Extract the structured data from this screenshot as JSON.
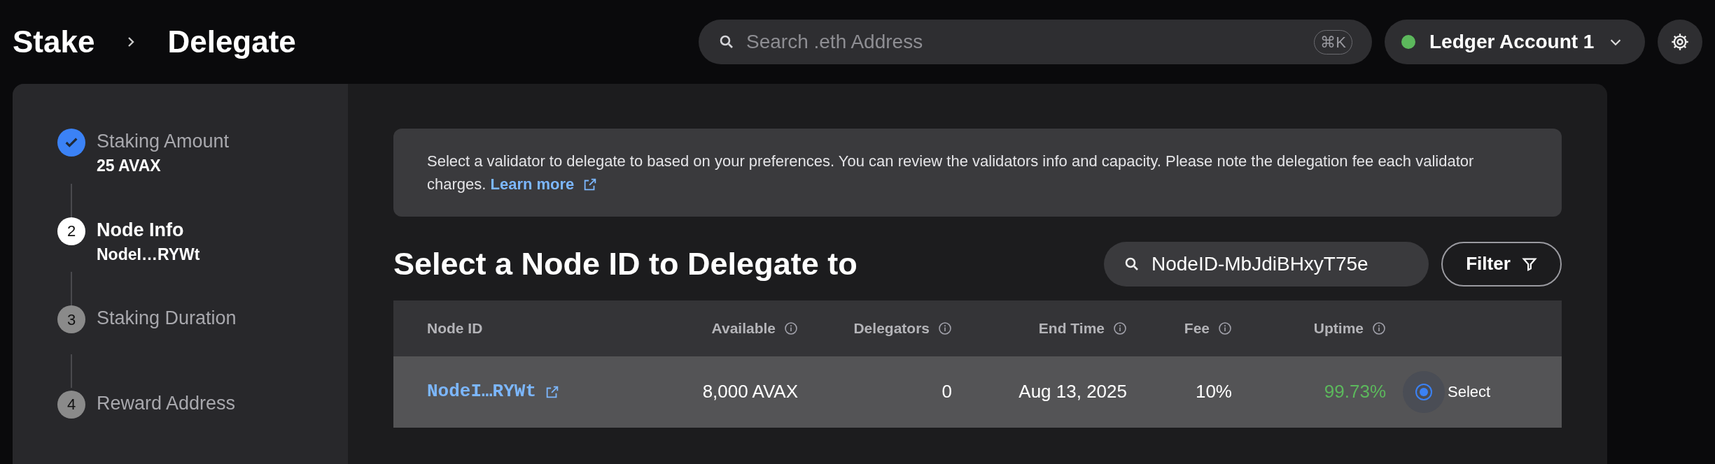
{
  "breadcrumb": [
    "Stake",
    "Delegate"
  ],
  "search": {
    "placeholder": "Search .eth Address",
    "shortcut": "⌘K"
  },
  "account": {
    "name": "Ledger Account 1",
    "connected": true
  },
  "steps": [
    {
      "kind": "done",
      "label": "Staking Amount",
      "value": "25 AVAX"
    },
    {
      "kind": "current",
      "number": "2",
      "label": "Node Info",
      "value": "NodeI…RYWt"
    },
    {
      "kind": "upcoming",
      "number": "3",
      "label": "Staking Duration"
    },
    {
      "kind": "upcoming",
      "number": "4",
      "label": "Reward Address"
    }
  ],
  "info_banner": {
    "text": "Select a validator to delegate to based on your preferences. You can review the validators info and capacity. Please note the delegation fee each validator charges.",
    "link": "Learn more"
  },
  "heading": "Select a Node ID to Delegate to",
  "node_search": {
    "value": "NodeID-MbJdiBHxyT75e"
  },
  "filter_button": "Filter",
  "table": {
    "columns": [
      {
        "label": "Node ID"
      },
      {
        "label": "Available",
        "info": true
      },
      {
        "label": "Delegators",
        "info": true
      },
      {
        "label": "End Time",
        "info": true
      },
      {
        "label": "Fee",
        "info": true
      },
      {
        "label": "Uptime",
        "info": true
      }
    ],
    "rows": [
      {
        "node_id": "NodeI…RYWt",
        "available": "8,000 AVAX",
        "delegators": "0",
        "end_time": "Aug 13, 2025",
        "fee": "10%",
        "uptime": "99.73%",
        "color": "#5cb85c",
        "selected": true,
        "select_label": "Select"
      }
    ]
  }
}
